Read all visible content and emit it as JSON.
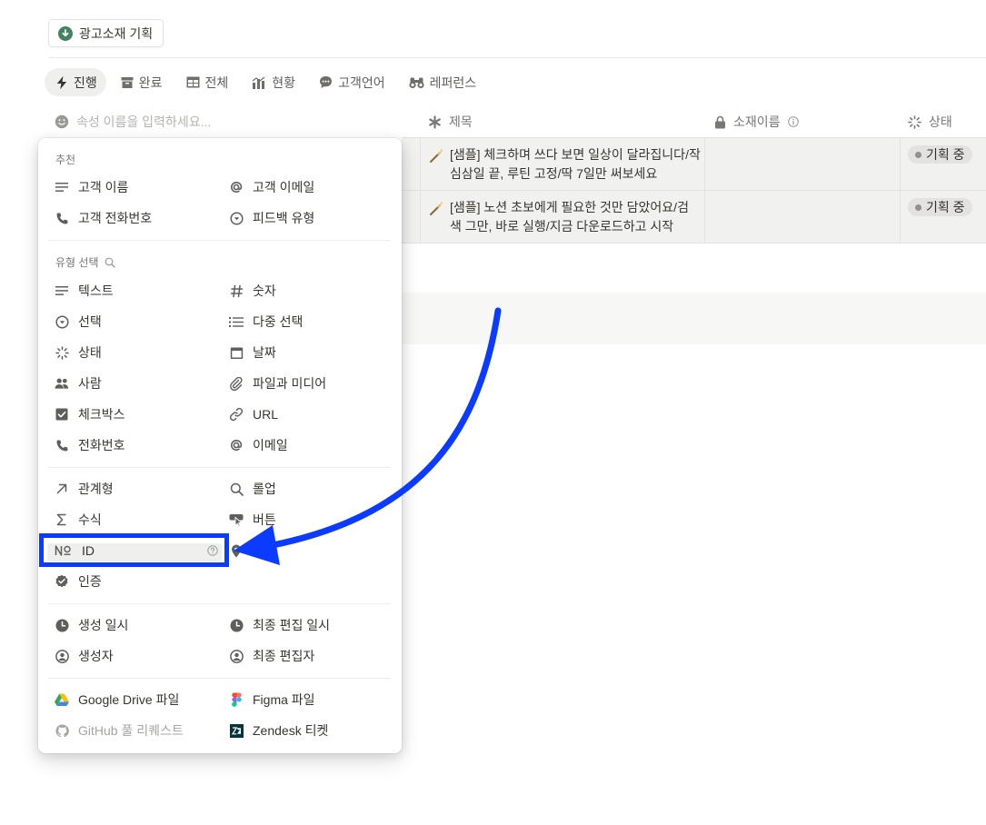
{
  "toolbar": {
    "template_button": "광고소재 기획"
  },
  "tabs": [
    {
      "label": "진행",
      "icon": "lightning-icon",
      "active": true
    },
    {
      "label": "완료",
      "icon": "archive-icon"
    },
    {
      "label": "전체",
      "icon": "table-icon"
    },
    {
      "label": "현황",
      "icon": "chart-icon"
    },
    {
      "label": "고객언어",
      "icon": "chat-bubble-icon"
    },
    {
      "label": "레퍼런스",
      "icon": "binoculars-icon"
    }
  ],
  "table": {
    "property_name_placeholder": "속성 이름을 입력하세요...",
    "columns": [
      {
        "label": "제목",
        "icon": "asterisk-icon"
      },
      {
        "label": "소재이름",
        "icon": "lock-icon"
      },
      {
        "label": "상태",
        "icon": "status-spinner-icon"
      }
    ],
    "rows": [
      {
        "title_line1": "[샘플] 체크하며 쓰다 보면 일상이 달라집니다/작",
        "title_line2": "심삼일 끝, 루틴 고정/딱 7일만 써보세요",
        "status": "기획 중"
      },
      {
        "title_line1": "[샘플] 노션 초보에게 필요한 것만 담았어요/검",
        "title_line2": "색 그만, 바로 실행/지금 다운로드하고 시작",
        "status": "기획 중"
      }
    ]
  },
  "menu": {
    "suggested_label": "추천",
    "suggested": [
      {
        "label": "고객 이름",
        "icon": "text-lines-icon"
      },
      {
        "label": "고객 이메일",
        "icon": "at-sign-icon"
      },
      {
        "label": "고객 전화번호",
        "icon": "phone-icon"
      },
      {
        "label": "피드백 유형",
        "icon": "select-icon"
      }
    ],
    "type_label": "유형 선택",
    "types": [
      {
        "label": "텍스트",
        "icon": "text-lines-icon"
      },
      {
        "label": "숫자",
        "icon": "hash-icon"
      },
      {
        "label": "선택",
        "icon": "select-icon"
      },
      {
        "label": "다중 선택",
        "icon": "list-icon"
      },
      {
        "label": "상태",
        "icon": "status-spinner-icon"
      },
      {
        "label": "날짜",
        "icon": "calendar-icon"
      },
      {
        "label": "사람",
        "icon": "people-icon"
      },
      {
        "label": "파일과 미디어",
        "icon": "paperclip-icon"
      },
      {
        "label": "체크박스",
        "icon": "checkbox-icon"
      },
      {
        "label": "URL",
        "icon": "link-icon"
      },
      {
        "label": "전화번호",
        "icon": "phone-icon"
      },
      {
        "label": "이메일",
        "icon": "at-sign-icon"
      }
    ],
    "advanced": [
      {
        "label": "관계형",
        "icon": "arrow-up-right-icon"
      },
      {
        "label": "롤업",
        "icon": "magnifier-icon"
      },
      {
        "label": "수식",
        "icon": "sigma-icon"
      },
      {
        "label": "버튼",
        "icon": "cursor-click-icon"
      },
      {
        "label": "ID",
        "icon": "numero-icon",
        "highlighted": true
      },
      {
        "label": "",
        "icon": "location-pin-icon"
      },
      {
        "label": "인증",
        "icon": "verified-badge-icon"
      }
    ],
    "meta": [
      {
        "label": "생성 일시",
        "icon": "clock-icon"
      },
      {
        "label": "최종 편집 일시",
        "icon": "clock-icon"
      },
      {
        "label": "생성자",
        "icon": "user-circle-icon"
      },
      {
        "label": "최종 편집자",
        "icon": "user-circle-icon"
      }
    ],
    "integrations": [
      {
        "label": "Google Drive 파일",
        "icon": "google-drive-icon"
      },
      {
        "label": "Figma 파일",
        "icon": "figma-icon"
      },
      {
        "label": "GitHub 풀 리퀘스트",
        "icon": "github-icon",
        "disabled": true
      },
      {
        "label": "Zendesk 티켓",
        "icon": "zendesk-icon"
      }
    ]
  },
  "annotation": {
    "arrow_color": "#0a3bff",
    "box_color": "#0a3bff"
  }
}
